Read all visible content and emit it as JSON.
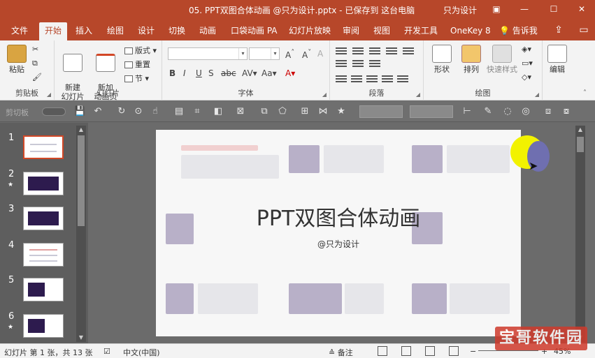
{
  "window": {
    "title": "05. PPT双图合体动画 @只为设计.pptx - 已保存到 这台电脑",
    "user": "只为设计"
  },
  "tabs": [
    {
      "label": "文件"
    },
    {
      "label": "开始",
      "active": true
    },
    {
      "label": "插入"
    },
    {
      "label": "绘图"
    },
    {
      "label": "设计"
    },
    {
      "label": "切换"
    },
    {
      "label": "动画"
    },
    {
      "label": "口袋动画 PA"
    },
    {
      "label": "幻灯片放映"
    },
    {
      "label": "审阅"
    },
    {
      "label": "视图"
    },
    {
      "label": "开发工具"
    },
    {
      "label": "OneKey 8"
    },
    {
      "label": "告诉我"
    }
  ],
  "ribbon": {
    "clipboard": {
      "paste": "粘贴",
      "group": "剪贴板"
    },
    "slides": {
      "new_slide": "新建\n幻灯片",
      "add_anim": "新加\n动画页",
      "layout": "版式",
      "reset": "重置",
      "section": "节",
      "group": "幻灯片"
    },
    "font": {
      "group": "字体",
      "font_name": "",
      "font_size": ""
    },
    "paragraph": {
      "group": "段落"
    },
    "drawing": {
      "shapes": "形状",
      "arrange": "排列",
      "quick_styles": "快速样式",
      "group": "绘图"
    },
    "editing": {
      "label": "编辑"
    }
  },
  "qat": {
    "draw_label": "剪切板"
  },
  "slides_pane": {
    "items": [
      {
        "num": "1",
        "star": false
      },
      {
        "num": "2",
        "star": true
      },
      {
        "num": "3",
        "star": false
      },
      {
        "num": "4",
        "star": false
      },
      {
        "num": "5",
        "star": false
      },
      {
        "num": "6",
        "star": true
      }
    ]
  },
  "slide": {
    "title": "PPT双图合体动画",
    "subtitle": "@只为设计"
  },
  "status": {
    "slide_info": "幻灯片 第 1 张，共 13 张",
    "language": "中文(中国)",
    "notes": "备注",
    "zoom": "45%"
  },
  "watermark": "宝哥软件园",
  "colors": {
    "accent": "#b7472a",
    "selection": "#d24726"
  }
}
